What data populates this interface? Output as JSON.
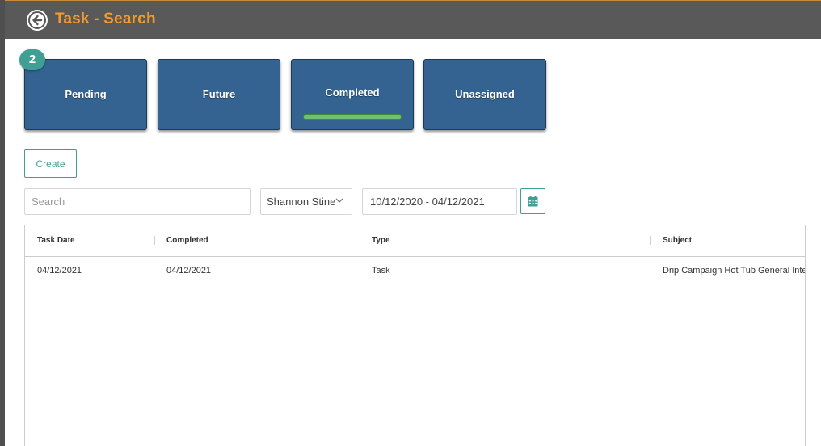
{
  "header": {
    "title": "Task - Search",
    "back_icon": "back-arrow-circle-icon",
    "accent_color": "#f19a2e",
    "background_color": "#595959"
  },
  "tabs": [
    {
      "label": "Pending",
      "badge": "2",
      "active": false
    },
    {
      "label": "Future",
      "active": false
    },
    {
      "label": "Completed",
      "active": true
    },
    {
      "label": "Unassigned",
      "active": false
    }
  ],
  "colors": {
    "tile": "#346392",
    "badge": "#3f9f93",
    "active_indicator": "#6fc16f",
    "outline_accent": "#3f9f93"
  },
  "toolbar": {
    "create_label": "Create"
  },
  "filters": {
    "search_placeholder": "Search",
    "search_value": "",
    "user": "Shannon Stine",
    "date_range": "10/12/2020 - 04/12/2021",
    "calendar_icon": "calendar-icon"
  },
  "table": {
    "columns": [
      "Task Date",
      "Completed",
      "Type",
      "Subject"
    ],
    "rows": [
      {
        "task_date": "04/12/2021",
        "completed": "04/12/2021",
        "type": "Task",
        "subject": "Drip Campaign Hot Tub General Inte"
      }
    ]
  }
}
